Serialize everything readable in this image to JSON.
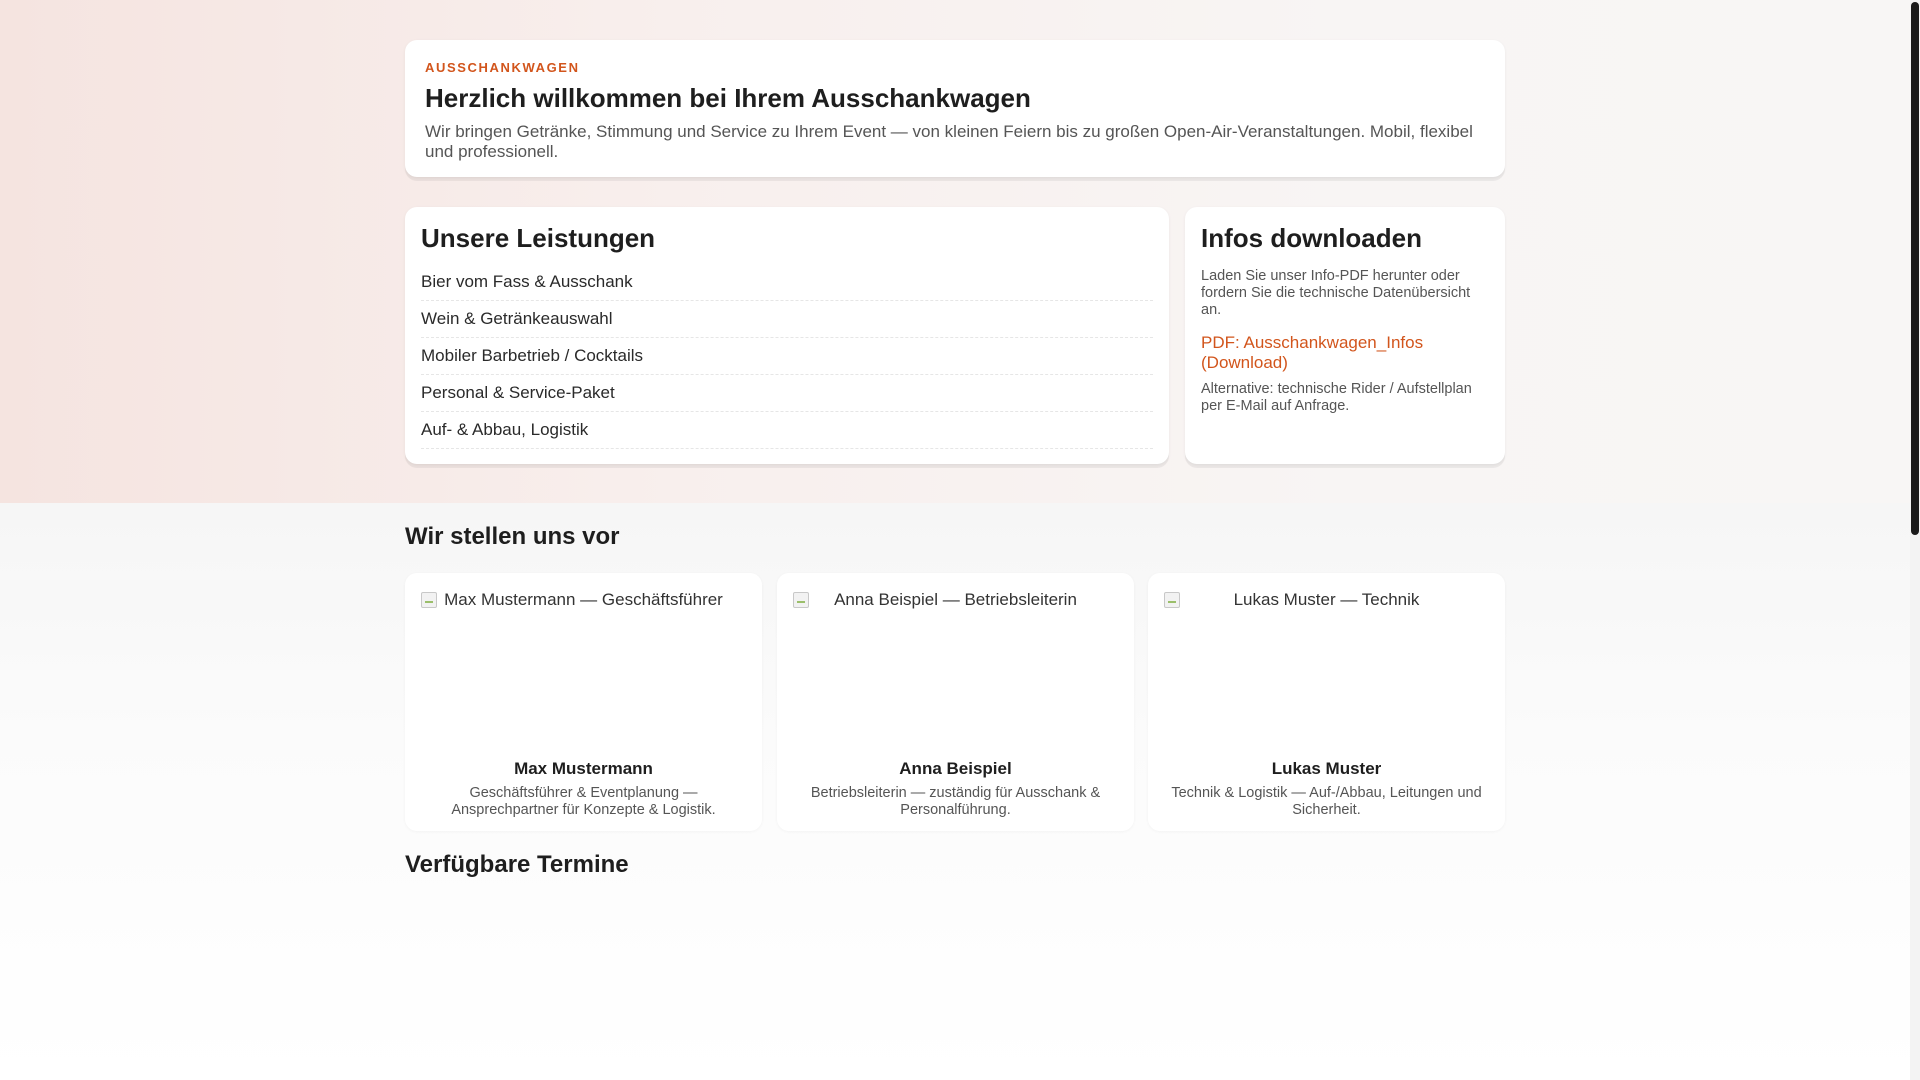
{
  "hero": {
    "eyebrow": "AUSSCHANKWAGEN",
    "title": "Herzlich willkommen bei Ihrem Ausschankwagen",
    "description": "Wir bringen Getränke, Stimmung und Service zu Ihrem Event — von kleinen Feiern bis zu großen Open-Air-Veranstaltungen. Mobil, flexibel und professionell."
  },
  "services": {
    "title": "Unsere Leistungen",
    "items": [
      "Bier vom Fass & Ausschank",
      "Wein & Getränkeauswahl",
      "Mobiler Barbetrieb / Cocktails",
      "Personal & Service-Paket",
      "Auf- & Abbau, Logistik"
    ]
  },
  "downloads": {
    "title": "Infos downloaden",
    "description": "Laden Sie unser Info-PDF herunter oder fordern Sie die technische Datenübersicht an.",
    "pdf_link": "PDF: Ausschankwagen_Infos (Download)",
    "alternative": "Alternative: technische Rider / Aufstellplan per E-Mail auf Anfrage."
  },
  "team": {
    "title": "Wir stellen uns vor",
    "members": [
      {
        "photo_alt": "Max Mustermann — Geschäftsführer",
        "name": "Max Mustermann",
        "role": "Geschäftsführer & Eventplanung — Ansprechpartner für Konzepte & Logistik."
      },
      {
        "photo_alt": "Anna Beispiel — Betriebsleiterin",
        "name": "Anna Beispiel",
        "role": "Betriebsleiterin — zuständig für Ausschank & Personalführung."
      },
      {
        "photo_alt": "Lukas Muster — Technik",
        "name": "Lukas Muster",
        "role": "Technik & Logistik — Auf-/Abbau, Leitungen und Sicherheit."
      }
    ]
  },
  "dates": {
    "title": "Verfügbare Termine"
  },
  "colors": {
    "accent": "#d2551c",
    "text": "#1e1e1e",
    "muted": "#555555"
  }
}
